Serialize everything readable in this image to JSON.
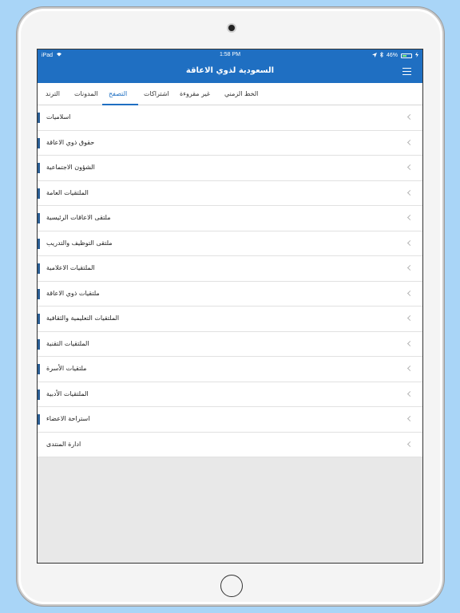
{
  "status_bar": {
    "device": "iPad",
    "time": "1:58 PM",
    "battery": "46%",
    "battery_level": 0.46
  },
  "header": {
    "title": "السعودية لذوي الاعاقة"
  },
  "tabs": [
    {
      "label": "الخط الزمني",
      "active": false
    },
    {
      "label": "غير مقروءة",
      "active": false
    },
    {
      "label": "اشتراكات",
      "active": false
    },
    {
      "label": "التصفح",
      "active": true
    },
    {
      "label": "المدونات",
      "active": false
    },
    {
      "label": "الترند",
      "active": false
    }
  ],
  "forums": [
    {
      "label": "اسلاميات",
      "marker": true
    },
    {
      "label": "حقوق ذوي الاعاقة",
      "marker": true
    },
    {
      "label": "الشؤون الاجتماعية",
      "marker": true
    },
    {
      "label": "الملتقيات العامة",
      "marker": true
    },
    {
      "label": "ملتقى الاعاقات الرئيسية",
      "marker": true
    },
    {
      "label": "ملتقى التوظيف والتدريب",
      "marker": true
    },
    {
      "label": "الملتقيات الاعلامية",
      "marker": true
    },
    {
      "label": "ملتقيات ذوي الاعاقة",
      "marker": true
    },
    {
      "label": "الملتقيات التعليمية والثقافية",
      "marker": true
    },
    {
      "label": "الملتقيات التقنية",
      "marker": true
    },
    {
      "label": "ملتقيات الأسرة",
      "marker": true
    },
    {
      "label": "الملتقيات الأدبية",
      "marker": true
    },
    {
      "label": "استراحة الاعضاء",
      "marker": true
    },
    {
      "label": "ادارة المنتدى",
      "marker": false
    }
  ],
  "colors": {
    "accent": "#1f6fc2",
    "marker": "#2a5d93",
    "background": "#a9d5f7"
  },
  "icons": {
    "menu": "hamburger-menu-icon",
    "chevron": "chevron-left-icon",
    "wifi": "wifi-icon",
    "location": "location-arrow-icon",
    "bluetooth": "bluetooth-icon",
    "battery": "battery-icon"
  }
}
